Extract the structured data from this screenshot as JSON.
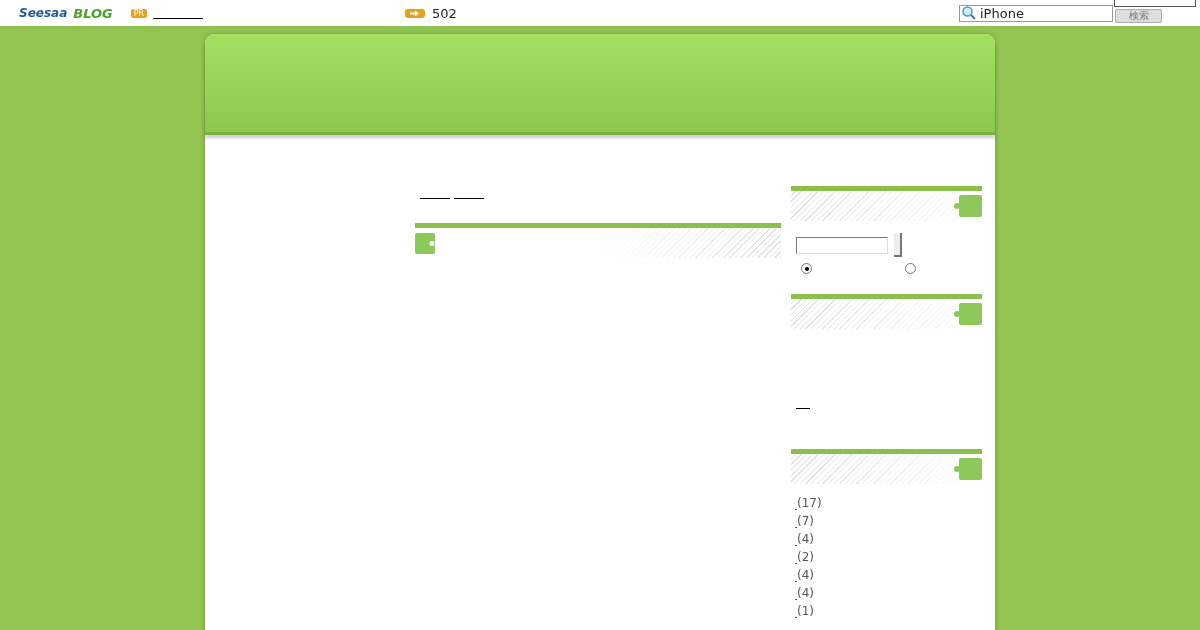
{
  "topbar": {
    "logo": "Seesaa",
    "logo_sub": "BLOG",
    "pr_badge": "PR",
    "counter": "502",
    "search": {
      "value": "iPhone",
      "button": "検索"
    }
  },
  "sidebar": {
    "search": {
      "options": [
        {
          "selected": true
        },
        {
          "selected": false
        }
      ]
    },
    "categories": [
      {
        "count": "(17)"
      },
      {
        "count": "(7)"
      },
      {
        "count": "(4)"
      },
      {
        "count": "(2)"
      },
      {
        "count": "(4)"
      },
      {
        "count": "(4)"
      },
      {
        "count": "(1)"
      }
    ]
  }
}
